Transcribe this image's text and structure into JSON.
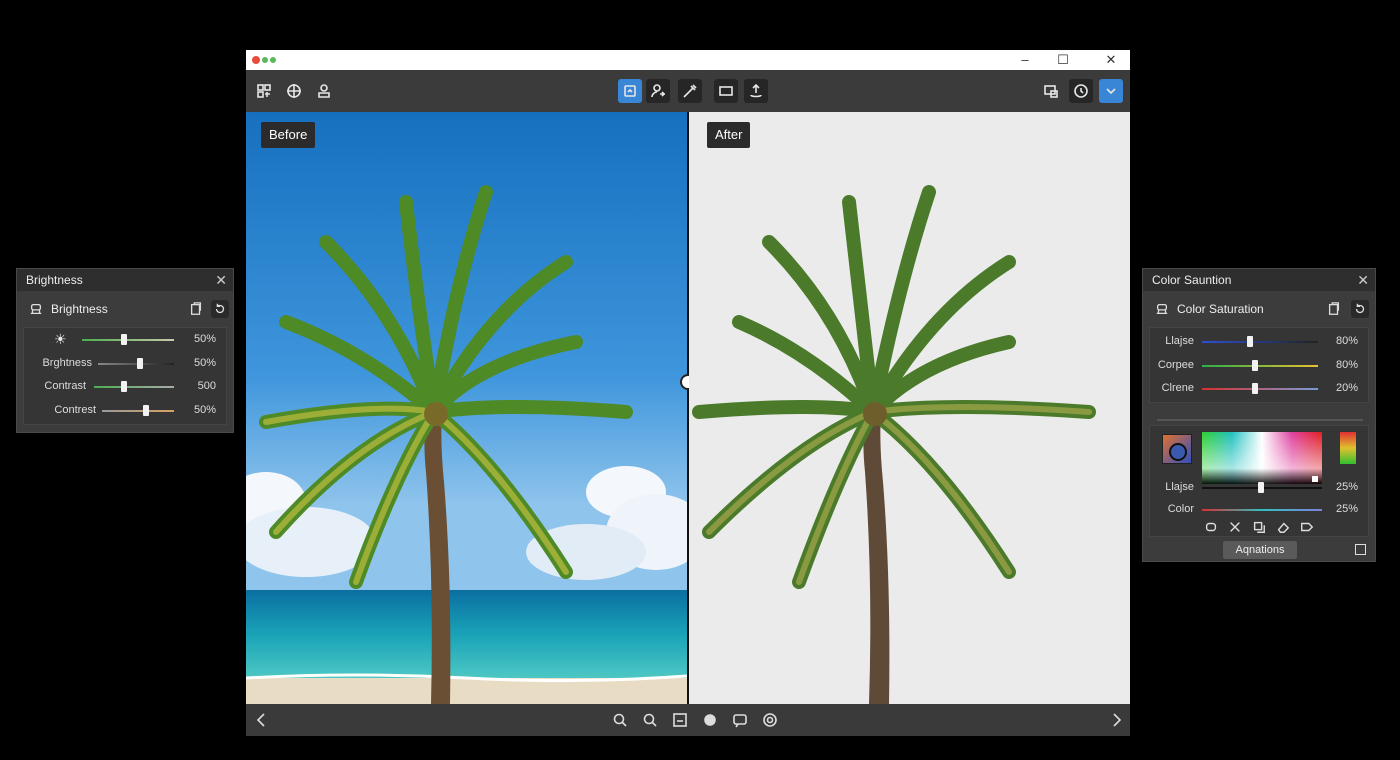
{
  "viewer": {
    "before_label": "Before",
    "after_label": "After"
  },
  "window": {
    "minimize": "–",
    "maximize": "☐",
    "close": "✕"
  },
  "brightness_panel": {
    "title": "Brightness",
    "section_title": "Brightness",
    "rows": [
      {
        "label": "",
        "value": "50%",
        "level": 0.45
      },
      {
        "label": "Brghtness",
        "value": "50%",
        "level": 0.55
      },
      {
        "label": "Contrast",
        "value": "500",
        "level": 0.4
      },
      {
        "label": "Contrest",
        "value": "50%",
        "level": 0.6
      }
    ]
  },
  "saturation_panel": {
    "title": "Color Sauntion",
    "section_title": "Color Saturation",
    "rows": [
      {
        "label": "Llajse",
        "value": "80%",
        "level": 0.42
      },
      {
        "label": "Corpee",
        "value": "80%",
        "level": 0.46
      },
      {
        "label": "Clrene",
        "value": "20%",
        "level": 0.46
      }
    ],
    "picker_rows": [
      {
        "label": "Llajse",
        "value": "25%"
      },
      {
        "label": "Color",
        "value": "25%"
      }
    ],
    "apply_button": "Aqnations"
  },
  "colors": {
    "accent": "#3a86d6",
    "panel": "#3c3c3c"
  }
}
